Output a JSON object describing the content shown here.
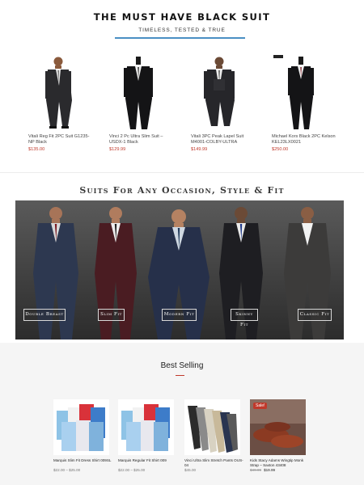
{
  "section1": {
    "title": "THE MUST HAVE BLACK SUIT",
    "subtitle": "TIMELESS, TESTED & TRUE",
    "products": [
      {
        "name": "Vitali Reg Fit 2PC Suit G1235-NP Black",
        "price": "$135.00"
      },
      {
        "name": "Vinci 2 Pc Ultra Slim Suit – USDX-1 Black",
        "price": "$129.99"
      },
      {
        "name": "Vitali 3PC Peak Lapel Suit M4001-COLBY-ULTRA",
        "price": "$149.99"
      },
      {
        "name": "Michael Kors Black 2PC Kelson KEL23LX0021",
        "price": "$250.00"
      }
    ]
  },
  "section2": {
    "title": "Suits For Any Occasion, Style & Fit",
    "buttons": [
      "Double Breast",
      "Slim Fit",
      "Modern Fit",
      "Skinny Fit",
      "Classic Fit"
    ]
  },
  "section3": {
    "title": "Best Selling",
    "sale_badge": "Sale!",
    "products": [
      {
        "name": "Marquis Slim Fit Dress Shirt 009SL",
        "price": "$22.00 – $25.00"
      },
      {
        "name": "Marquis Regular Fit Shirt 009",
        "price": "$22.00 – $25.00"
      },
      {
        "name": "Vinci Ultra Slim Stretch Pants OUS-04",
        "price": "$45.00"
      },
      {
        "name": "Kids Stacy Adams Wingtip Monk Strap – Saxton 43408",
        "old_price": "$49.99",
        "new_price": "$19.99"
      }
    ]
  },
  "colors": {
    "accent_blue": "#4a8fc4",
    "price_red": "#c0392b",
    "bg_grey": "#f5f5f5"
  }
}
